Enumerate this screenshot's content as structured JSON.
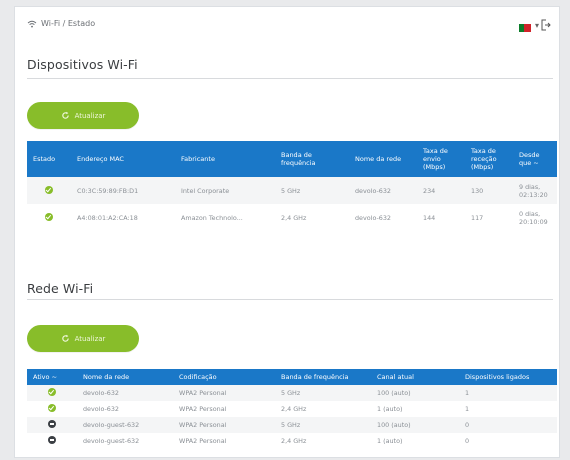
{
  "breadcrumb": {
    "text": "Wi-Fi / Estado"
  },
  "sections": {
    "devices_title": "Dispositivos Wi-Fi",
    "network_title": "Rede Wi-Fi"
  },
  "devices": {
    "refresh_label": "Atualizar",
    "columns": [
      "Estado",
      "Endereço MAC",
      "Fabricante",
      "Banda de frequência",
      "Nome da rede",
      "Taxa de envio (Mbps)",
      "Taxa de receção (Mbps)",
      "Desde que ~"
    ],
    "rows": [
      {
        "status": "on",
        "mac": "C0:3C:59:89:FB:D1",
        "vendor": "Intel Corporate",
        "band": "5 GHz",
        "network": "devolo-632",
        "tx": "234",
        "rx": "130",
        "since": "9 dias, 02:13:20"
      },
      {
        "status": "on",
        "mac": "A4:08:01:A2:CA:18",
        "vendor": "Amazon Technolo...",
        "band": "2,4 GHz",
        "network": "devolo-632",
        "tx": "144",
        "rx": "117",
        "since": "0 dias, 20:10:09"
      }
    ]
  },
  "network": {
    "refresh_label": "Atualizar",
    "columns": [
      "Ativo ~",
      "Nome da rede",
      "Codificação",
      "Banda de frequência",
      "Canal atual",
      "Dispositivos ligados"
    ],
    "rows": [
      {
        "status": "on",
        "name": "devolo-632",
        "encryption": "WPA2 Personal",
        "band": "5 GHz",
        "channel": "100 (auto)",
        "devices": "1"
      },
      {
        "status": "on",
        "name": "devolo-632",
        "encryption": "WPA2 Personal",
        "band": "2,4 GHz",
        "channel": "1 (auto)",
        "devices": "1"
      },
      {
        "status": "off",
        "name": "devolo-guest-632",
        "encryption": "WPA2 Personal",
        "band": "5 GHz",
        "channel": "100 (auto)",
        "devices": "0"
      },
      {
        "status": "off",
        "name": "devolo-guest-632",
        "encryption": "WPA2 Personal",
        "band": "2,4 GHz",
        "channel": "1 (auto)",
        "devices": "0"
      }
    ]
  },
  "colors": {
    "accent_green": "#88bd2a",
    "header_blue": "#1a78c8",
    "inactive": "#3b3f44"
  },
  "icons": {
    "breadcrumb": "wifi-icon",
    "language": "flag-pt-icon",
    "logout": "logout-icon",
    "refresh": "refresh-icon"
  }
}
